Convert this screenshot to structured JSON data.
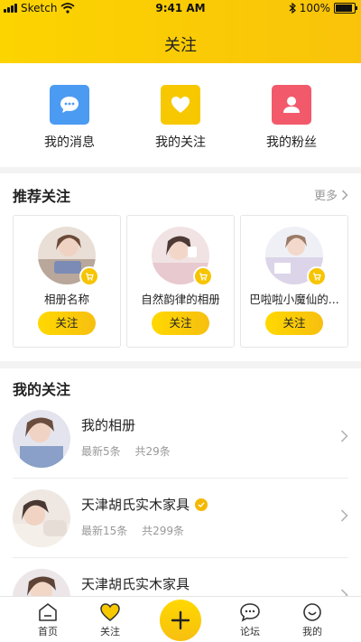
{
  "status_bar": {
    "carrier": "Sketch",
    "time": "9:41 AM",
    "battery": "100%"
  },
  "header": {
    "title": "关注"
  },
  "quick_actions": [
    {
      "label": "我的消息",
      "icon": "chat-bubble-icon",
      "color": "#4b9bf3"
    },
    {
      "label": "我的关注",
      "icon": "heart-icon",
      "color": "#f7c800"
    },
    {
      "label": "我的粉丝",
      "icon": "person-icon",
      "color": "#f25a6b"
    }
  ],
  "recommend": {
    "title": "推荐关注",
    "more": "更多",
    "cards": [
      {
        "name": "相册名称",
        "button": "关注"
      },
      {
        "name": "自然韵律的相册",
        "button": "关注"
      },
      {
        "name": "巴啦啦小魔仙的...",
        "button": "关注"
      }
    ]
  },
  "my_follows": {
    "title": "我的关注",
    "items": [
      {
        "title": "我的相册",
        "latest": "最新5条",
        "total": "共29条",
        "verified": false
      },
      {
        "title": "天津胡氏实木家具",
        "latest": "最新15条",
        "total": "共299条",
        "verified": true
      },
      {
        "title": "天津胡氏实木家具",
        "latest": "",
        "total": "",
        "verified": false
      }
    ]
  },
  "tabbar": {
    "items": [
      {
        "label": "首页",
        "icon": "home-icon"
      },
      {
        "label": "关注",
        "icon": "heart-icon"
      },
      {
        "label": "论坛",
        "icon": "forum-icon"
      },
      {
        "label": "我的",
        "icon": "profile-icon"
      }
    ]
  },
  "colors": {
    "accent": "#f9c80e",
    "blue": "#4b9bf3",
    "pink": "#f25a6b"
  }
}
